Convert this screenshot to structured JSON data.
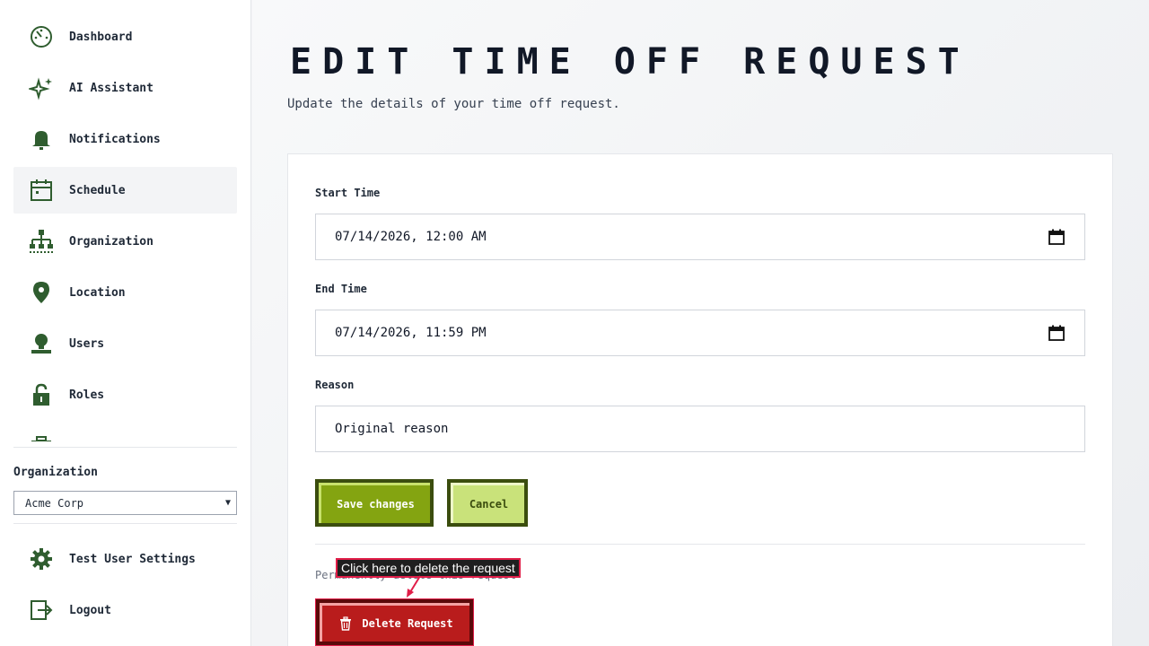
{
  "sidebar": {
    "items": [
      {
        "label": "Dashboard",
        "icon": "dashboard-icon"
      },
      {
        "label": "AI Assistant",
        "icon": "sparkle-icon"
      },
      {
        "label": "Notifications",
        "icon": "bell-icon"
      },
      {
        "label": "Schedule",
        "icon": "calendar-icon",
        "active": true
      },
      {
        "label": "Organization",
        "icon": "org-chart-icon"
      },
      {
        "label": "Location",
        "icon": "map-pin-icon"
      },
      {
        "label": "Users",
        "icon": "user-icon"
      },
      {
        "label": "Roles",
        "icon": "lock-icon"
      }
    ],
    "org_label": "Organization",
    "org_selected": "Acme Corp",
    "settings_label": "Test User Settings",
    "logout_label": "Logout"
  },
  "page": {
    "title": "EDIT TIME OFF REQUEST",
    "subtitle": "Update the details of your time off request."
  },
  "form": {
    "start_label": "Start Time",
    "start_value": "07/14/2026, 12:00 AM",
    "end_label": "End Time",
    "end_value": "07/14/2026, 11:59 PM",
    "reason_label": "Reason",
    "reason_value": "Original reason",
    "save_label": "Save changes",
    "cancel_label": "Cancel",
    "danger_note": "Permanently delete this request",
    "delete_label": "Delete Request"
  },
  "tooltip": {
    "text": "Click here to delete the request"
  },
  "colors": {
    "accent_green": "#84a411",
    "dark_green": "#3b4d0e",
    "danger_red": "#b91c1c",
    "icon_green": "#2f5d2f"
  }
}
